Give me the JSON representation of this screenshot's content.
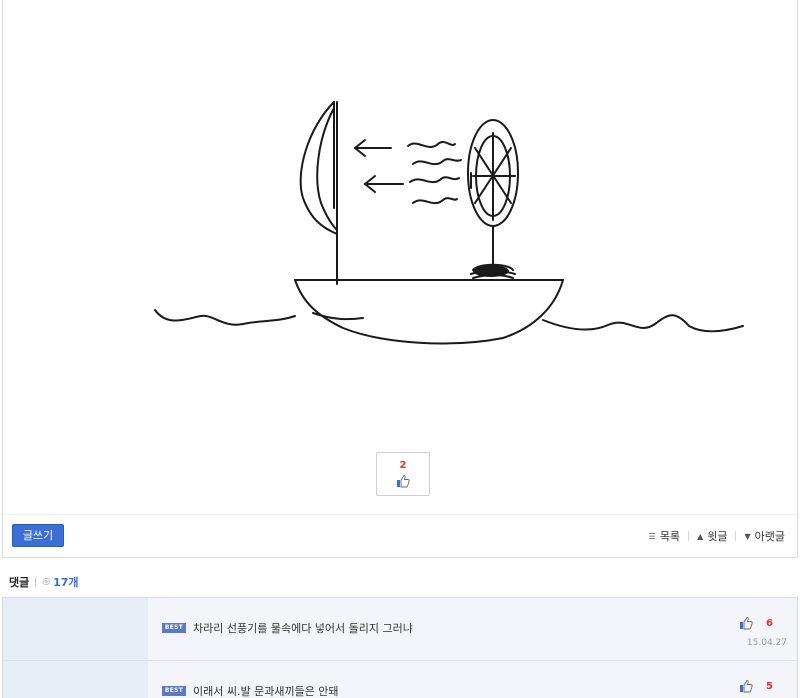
{
  "post": {
    "like_count": "2",
    "thumbs_icon": "thumbs-up-icon"
  },
  "bottom_bar": {
    "write_label": "글쓰기",
    "list_label": "목록",
    "prev_label": "윗글",
    "next_label": "아랫글",
    "icons": [
      "list-icon",
      "up-triangle-icon",
      "down-triangle-icon"
    ]
  },
  "comments": {
    "title": "댓글",
    "count": "17개",
    "items": [
      {
        "badge": "BEST",
        "text": "차라리 선풍기를 물속에다 넣어서 돌리지 그러냐",
        "likes": "6",
        "date": "15.04.27"
      },
      {
        "badge": "BEST",
        "text": "이래서 씨.발 문과새끼들은 안돼",
        "likes": "5",
        "date": ""
      }
    ]
  },
  "colors": {
    "accent": "#3b6fd6",
    "like_red": "#d9352b",
    "comment_bg": "#eef1f8"
  }
}
